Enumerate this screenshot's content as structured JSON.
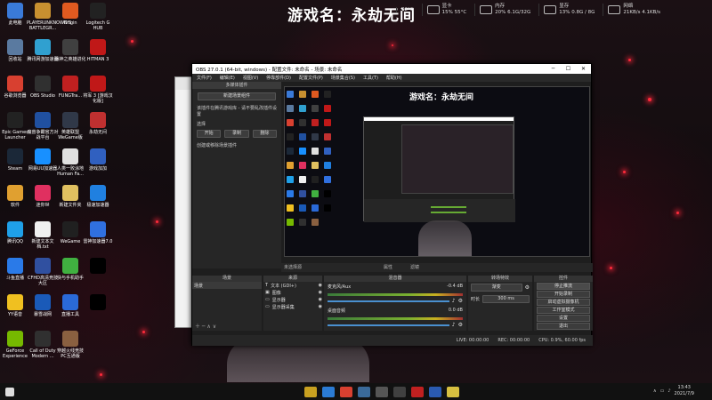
{
  "hud": {
    "game_title": "游戏名：永劫无间",
    "temp1": "42°C",
    "disk_label": "显卡",
    "disk_val": "15%  55°C",
    "mem_label": "内存",
    "mem_val": "20%  6.1G/32G",
    "gpu_label": "显存",
    "gpu_val": "13%  0.8G / 8G",
    "net_label": "网络",
    "net_val": "21KB/s  4.1KB/s"
  },
  "desktop_icons": [
    {
      "label": "此电脑",
      "color": "#3a7ad8"
    },
    {
      "label": "PLAYERUNKNOWN'S BATTLEGR...",
      "color": "#c89030"
    },
    {
      "label": "Origin",
      "color": "#e05a20"
    },
    {
      "label": "Logitech G HUB",
      "color": "#222"
    },
    {
      "label": "回收站",
      "color": "#5a7aa0"
    },
    {
      "label": "腾讯网游加速器",
      "color": "#30a0d0"
    },
    {
      "label": "战神之英雄进化",
      "color": "#404040"
    },
    {
      "label": "HITMAN 3",
      "color": "#c01818"
    },
    {
      "label": "谷歌浏览器",
      "color": "#d84030"
    },
    {
      "label": "OBS Studio",
      "color": "#303030"
    },
    {
      "label": "FUNGTra...",
      "color": "#c02020"
    },
    {
      "label": "将军 3 [游戏汉化版]",
      "color": "#c01818"
    },
    {
      "label": "Epic Games Launcher",
      "color": "#222"
    },
    {
      "label": "魔兽争霸官方对战平台",
      "color": "#2050a0"
    },
    {
      "label": "英雄联盟WeGame版",
      "color": "#303848"
    },
    {
      "label": "永劫无间",
      "color": "#c03030"
    },
    {
      "label": "Steam",
      "color": "#1b2838"
    },
    {
      "label": "网易UU加速器",
      "color": "#1890ff"
    },
    {
      "label": "人类一败涂地 Human Fa...",
      "color": "#e0e0e0"
    },
    {
      "label": "游戏加加",
      "color": "#3060c0"
    },
    {
      "label": "软件",
      "color": "#e0a030"
    },
    {
      "label": "迷你世",
      "color": "#e03060"
    },
    {
      "label": "新建文件夹",
      "color": "#e0c060"
    },
    {
      "label": "极速加速器",
      "color": "#2080e0"
    },
    {
      "label": "腾讯QQ",
      "color": "#1fa0e8"
    },
    {
      "label": "新建文本文档.txt",
      "color": "#f0f0f0"
    },
    {
      "label": "WeGame",
      "color": "#202020"
    },
    {
      "label": "雷神加速器7.0",
      "color": "#3070e0"
    },
    {
      "label": "斗鱼直播",
      "color": "#2a7ae8"
    },
    {
      "label": "CFHD高清竞技大区",
      "color": "#3050a0"
    },
    {
      "label": "快与手机助手",
      "color": "#40b040"
    },
    {
      "label": "",
      "color": "#000"
    },
    {
      "label": "YY语音",
      "color": "#f0c020"
    },
    {
      "label": "暴雪战网",
      "color": "#1a5ab8"
    },
    {
      "label": "直播工具",
      "color": "#2a6ad8"
    },
    {
      "label": "",
      "color": "#000"
    },
    {
      "label": "GeForce Experience",
      "color": "#76b900"
    },
    {
      "label": "Call of Duty Modern ...",
      "color": "#303030"
    },
    {
      "label": "穿越火线竞技PC互通版",
      "color": "#8a6040"
    }
  ],
  "obs": {
    "title": "OBS 27.0.1 (64-bit, windows) - 配置文件: 未命名 - 场景: 未命名",
    "menu": [
      "文件(F)",
      "编辑(E)",
      "视图(V)",
      "停靠部件(D)",
      "配置文件(P)",
      "场景集合(S)",
      "工具(T)",
      "帮助(H)"
    ],
    "left_panel_title": "多媒体插件",
    "left_btn": "新建场景组件",
    "left_text": "该插件在腾讯游戏库 - 请不要乱改插件设置",
    "left_sub": "选择",
    "btn_start": "开始",
    "btn_record": "录制",
    "btn_delete": "删除",
    "left_footer": "创建或移除场景插件",
    "scene_bar": "未选择源",
    "scene_props": "属性",
    "scene_filters": "滤镜",
    "dock_scenes": "场景",
    "dock_scene_item": "场景",
    "dock_sources": "来源",
    "sources": [
      "文本 (GDI+)",
      "图像",
      "显示器",
      "显示器采集"
    ],
    "dock_mixer": "混音器",
    "mixer": [
      {
        "name": "麦克风/Aux",
        "db": "-0.4 dB"
      },
      {
        "name": "桌面音频",
        "db": "0.0 dB"
      }
    ],
    "dock_transitions": "转场特效",
    "trans_type": "渐变",
    "trans_label": "时长",
    "trans_duration": "300 ms",
    "dock_controls": "控件",
    "controls": [
      "停止推流",
      "开始录制",
      "启动虚拟摄像机",
      "工作室模式",
      "设置",
      "退出"
    ],
    "status": {
      "live": "LIVE: 00:00:00",
      "rec": "REC: 00:00:00",
      "cpu": "CPU: 0.9%, 60.00 fps"
    }
  },
  "preview_title": "游戏名：永劫无间",
  "clock": {
    "time": "13:43",
    "date": "2021/7/9"
  }
}
